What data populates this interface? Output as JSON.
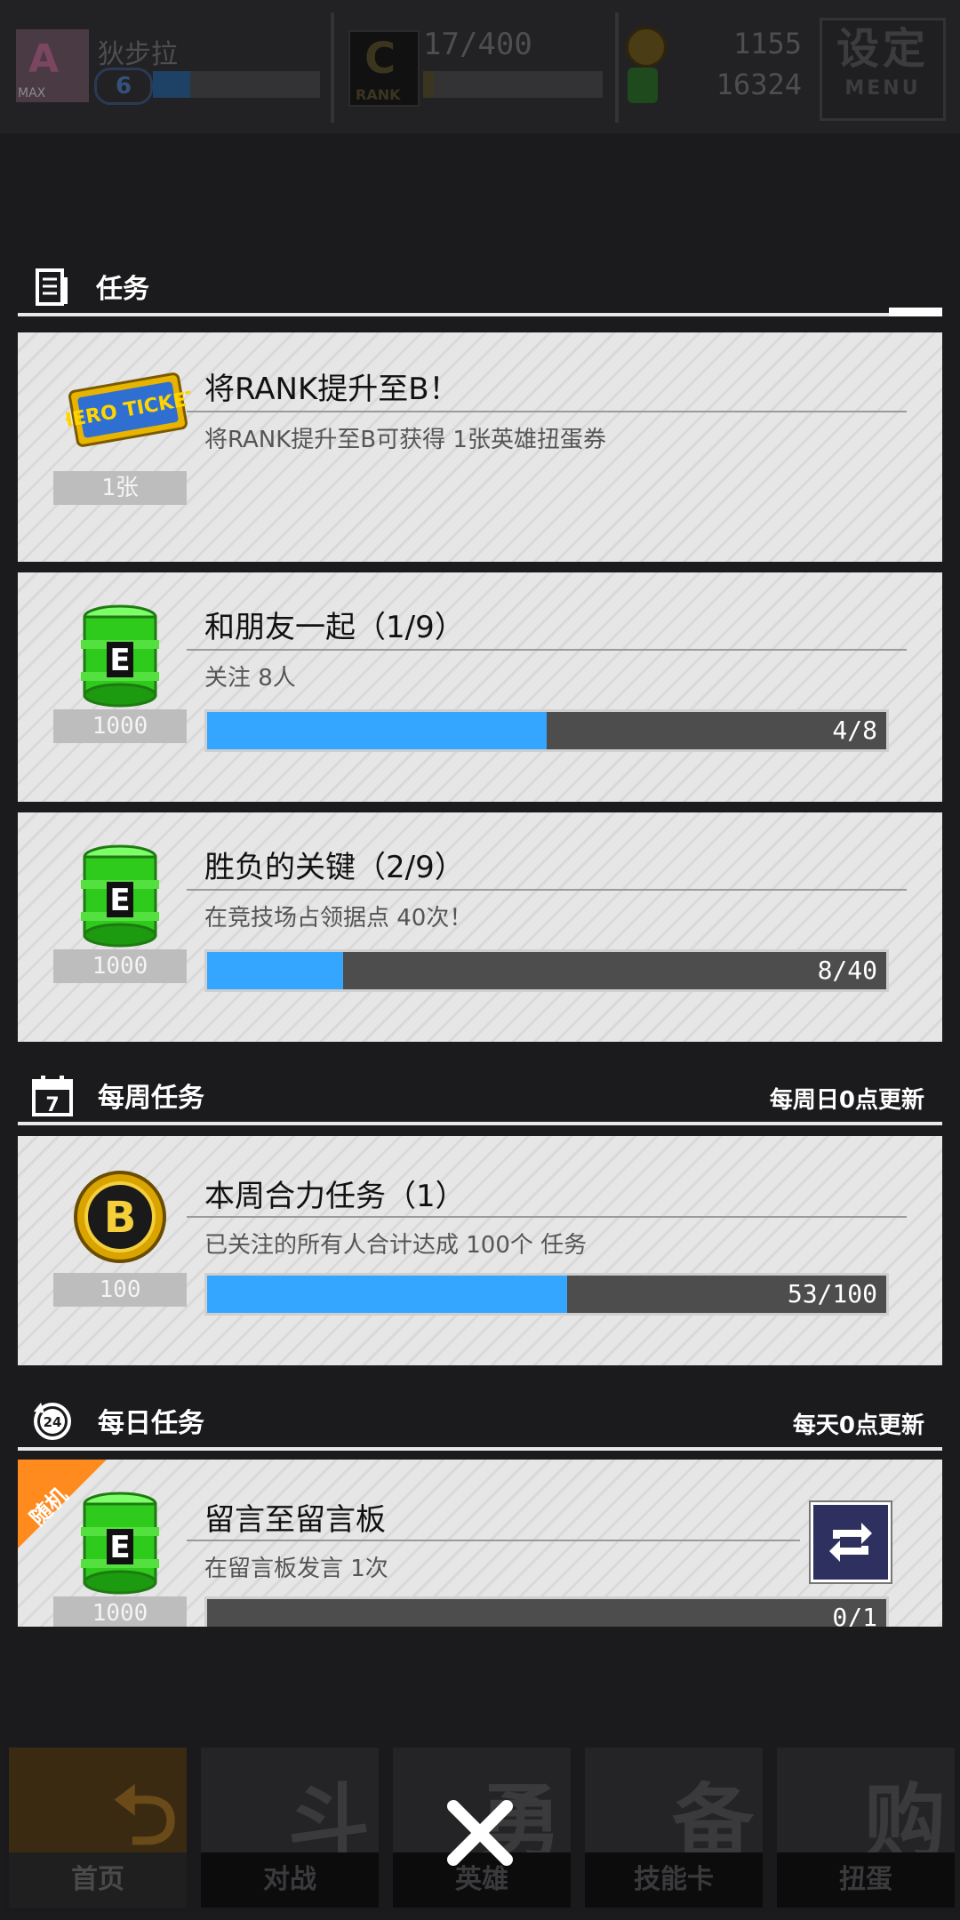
{
  "status_bar": {
    "player_name": "狄步拉",
    "level": "6",
    "avatar_tag": "MAX",
    "rank_letter": "C",
    "rank_label": "RANK",
    "rank_progress": "17/400",
    "gold": "1155",
    "energy": "16324",
    "settings_label": "设定",
    "settings_sub": "MENU"
  },
  "missions": {
    "title": "任务",
    "cards": [
      {
        "title": "将RANK提升至B！",
        "desc": "将RANK提升至B可获得  1张英雄扭蛋券",
        "reward": "1张",
        "icon": "hero-ticket-icon",
        "ticket_text": "HERO TICKET"
      },
      {
        "title": "和朋友一起（1/9）",
        "desc": "关注  8人",
        "reward": "1000",
        "icon": "energy-canister-icon",
        "progress_text": "4/8",
        "progress": 0.5
      },
      {
        "title": "胜负的关键（2/9）",
        "desc": "在竞技场占领据点  40次！",
        "reward": "1000",
        "icon": "energy-canister-icon",
        "progress_text": "8/40",
        "progress": 0.2
      }
    ]
  },
  "weekly": {
    "title": "每周任务",
    "note": "每周日0点更新",
    "icon_text": "7",
    "cards": [
      {
        "title": "本周合力任务（1）",
        "desc": "已关注的所有人合计达成  100个  任务",
        "reward": "100",
        "icon": "b-coin-icon",
        "progress_text": "53/100",
        "progress": 0.53
      }
    ]
  },
  "daily": {
    "title": "每日任务",
    "note": "每天0点更新",
    "icon_text": "24",
    "cards": [
      {
        "title": "留言至留言板",
        "desc": "在留言板发言  1次",
        "reward": "1000",
        "icon": "energy-canister-icon",
        "progress_text": "0/1",
        "progress": 0,
        "random_tag": "随机"
      }
    ]
  },
  "bottom_nav": {
    "items": [
      {
        "label": "首页",
        "art": "⮌"
      },
      {
        "label": "对战",
        "art": "斗"
      },
      {
        "label": "英雄",
        "art": "勇"
      },
      {
        "label": "技能卡",
        "art": "备"
      },
      {
        "label": "扭蛋",
        "art": "购"
      }
    ]
  },
  "colors": {
    "progress_fill": "#35a6ff",
    "random_tag": "#ff8a1e",
    "card_bg": "#e2e2e2"
  }
}
